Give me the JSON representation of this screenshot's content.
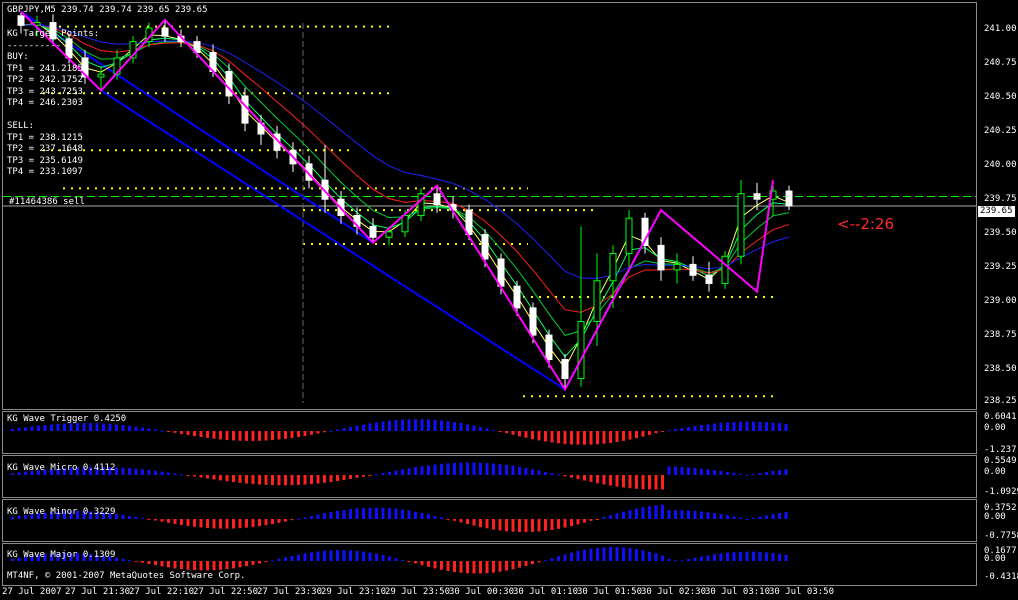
{
  "header": {
    "symbol_info": "GBPJPY,M5  239.74 239.74 239.65 239.65"
  },
  "target_panel": {
    "title": "KG Target Points:",
    "buy_label": "BUY:",
    "buy": [
      "TP1 = 241.2185",
      "TP2 = 242.1752",
      "TP3 = 243.7253",
      "TP4 = 246.2303"
    ],
    "sell_label": "SELL:",
    "sell": [
      "TP1 = 238.1215",
      "TP2 = 237.1648",
      "TP3 = 235.6149",
      "TP4 = 233.1097"
    ]
  },
  "order_label": "#11464386 sell",
  "countdown": "<--2:26",
  "current_price": "239.65",
  "price_axis": [
    "241.00",
    "240.75",
    "240.50",
    "240.25",
    "240.00",
    "239.75",
    "239.50",
    "239.25",
    "239.00",
    "238.75",
    "238.50",
    "238.25"
  ],
  "time_axis": [
    "27 Jul 2007",
    "27 Jul 21:30",
    "27 Jul 22:10",
    "27 Jul 22:50",
    "27 Jul 23:30",
    "29 Jul 23:10",
    "29 Jul 23:50",
    "30 Jul 00:30",
    "30 Jul 01:10",
    "30 Jul 01:50",
    "30 Jul 02:30",
    "30 Jul 03:10",
    "30 Jul 03:50"
  ],
  "indicators": [
    {
      "title": "KG Wave Trigger  0.4250",
      "scale": [
        "0.6041",
        "0.00",
        "-1.237"
      ]
    },
    {
      "title": "KG Wave Micro  0.4112",
      "scale": [
        "0.5549",
        "0.00",
        "-1.0929"
      ]
    },
    {
      "title": "KG Wave Minor  0.3229",
      "scale": [
        "0.3752",
        "0.00",
        "-0.7758"
      ]
    },
    {
      "title": "KG Wave Major  0.1309",
      "scale": [
        "0.1677",
        "0.00",
        "-0.4318"
      ]
    }
  ],
  "copyright": "MT4NF, © 2001-2007 MetaQuotes Software Corp.",
  "colors": {
    "bull": "#00ff00",
    "bear": "#ffffff",
    "zigzag": "#ff00ff",
    "trend": "#0000ff",
    "red_bar": "#ff2020",
    "blue_bar": "#1010ff"
  },
  "chart_data": {
    "type": "candlestick",
    "price_range": [
      238.2,
      241.1
    ],
    "candles": [
      [
        241.05,
        241.08,
        240.92,
        240.98
      ],
      [
        240.98,
        241.05,
        240.9,
        241.0
      ],
      [
        241.0,
        241.06,
        240.85,
        240.88
      ],
      [
        240.88,
        240.92,
        240.7,
        240.74
      ],
      [
        240.74,
        240.8,
        240.55,
        240.6
      ],
      [
        240.6,
        240.68,
        240.5,
        240.62
      ],
      [
        240.62,
        240.8,
        240.58,
        240.74
      ],
      [
        240.74,
        240.9,
        240.7,
        240.86
      ],
      [
        240.86,
        241.0,
        240.82,
        240.96
      ],
      [
        240.96,
        241.02,
        240.86,
        240.9
      ],
      [
        240.9,
        240.95,
        240.82,
        240.86
      ],
      [
        240.86,
        240.9,
        240.74,
        240.78
      ],
      [
        240.78,
        240.84,
        240.6,
        240.64
      ],
      [
        240.64,
        240.7,
        240.4,
        240.46
      ],
      [
        240.46,
        240.52,
        240.2,
        240.26
      ],
      [
        240.26,
        240.32,
        240.1,
        240.18
      ],
      [
        240.18,
        240.24,
        240.0,
        240.06
      ],
      [
        240.06,
        240.12,
        239.9,
        239.96
      ],
      [
        239.96,
        240.02,
        239.78,
        239.84
      ],
      [
        239.84,
        240.1,
        239.6,
        239.7
      ],
      [
        239.7,
        239.76,
        239.52,
        239.58
      ],
      [
        239.58,
        239.64,
        239.44,
        239.5
      ],
      [
        239.5,
        239.56,
        239.38,
        239.42
      ],
      [
        239.42,
        239.5,
        239.36,
        239.46
      ],
      [
        239.46,
        239.62,
        239.42,
        239.58
      ],
      [
        239.58,
        239.78,
        239.54,
        239.74
      ],
      [
        239.74,
        239.8,
        239.6,
        239.66
      ],
      [
        239.66,
        239.72,
        239.56,
        239.62
      ],
      [
        239.62,
        239.66,
        239.4,
        239.44
      ],
      [
        239.44,
        239.48,
        239.2,
        239.26
      ],
      [
        239.26,
        239.3,
        239.0,
        239.06
      ],
      [
        239.06,
        239.1,
        238.84,
        238.9
      ],
      [
        238.9,
        238.94,
        238.64,
        238.7
      ],
      [
        238.7,
        238.74,
        238.46,
        238.52
      ],
      [
        238.52,
        238.56,
        238.3,
        238.38
      ],
      [
        238.38,
        239.5,
        238.32,
        238.8
      ],
      [
        238.8,
        239.3,
        238.62,
        239.1
      ],
      [
        239.1,
        239.36,
        238.9,
        239.3
      ],
      [
        239.3,
        239.62,
        239.2,
        239.56
      ],
      [
        239.56,
        239.6,
        239.3,
        239.36
      ],
      [
        239.36,
        239.42,
        239.1,
        239.18
      ],
      [
        239.18,
        239.3,
        239.08,
        239.22
      ],
      [
        239.22,
        239.28,
        239.1,
        239.14
      ],
      [
        239.14,
        239.24,
        239.02,
        239.08
      ],
      [
        239.08,
        239.32,
        239.04,
        239.28
      ],
      [
        239.28,
        239.84,
        239.22,
        239.74
      ],
      [
        239.74,
        239.82,
        239.62,
        239.7
      ],
      [
        239.7,
        239.8,
        239.58,
        239.76
      ],
      [
        239.76,
        239.8,
        239.62,
        239.65
      ]
    ],
    "zigzag_points": [
      [
        0,
        241.08
      ],
      [
        5,
        240.5
      ],
      [
        9,
        241.02
      ],
      [
        22,
        239.38
      ],
      [
        26,
        239.8
      ],
      [
        34,
        238.3
      ],
      [
        40,
        239.62
      ],
      [
        46,
        239.02
      ],
      [
        47,
        239.84
      ]
    ],
    "targets": [
      240.97,
      240.48,
      240.06,
      239.78,
      239.62,
      239.37,
      238.98,
      238.25
    ]
  }
}
